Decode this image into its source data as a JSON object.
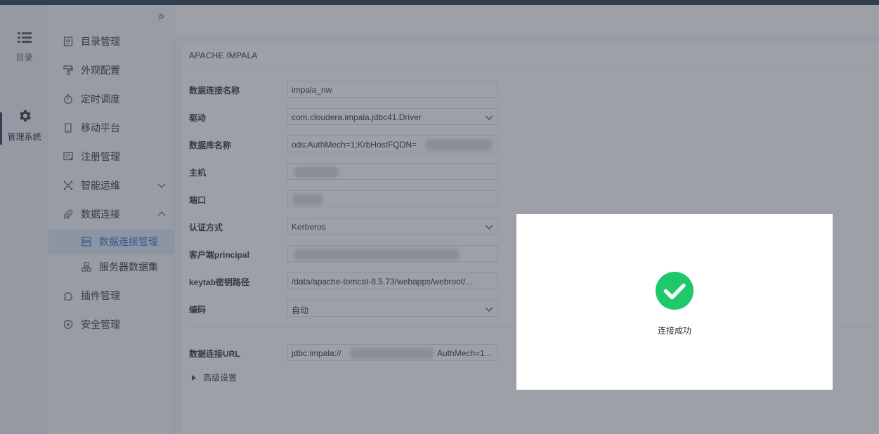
{
  "rail": {
    "items": [
      {
        "label": "目录",
        "icon": "list-icon"
      },
      {
        "label": "管理系统",
        "icon": "gear-icon"
      }
    ]
  },
  "menu": {
    "items": [
      {
        "label": "目录管理",
        "icon": "document-list-icon"
      },
      {
        "label": "外观配置",
        "icon": "paint-roller-icon"
      },
      {
        "label": "定时调度",
        "icon": "timer-icon"
      },
      {
        "label": "移动平台",
        "icon": "mobile-icon"
      },
      {
        "label": "注册管理",
        "icon": "register-icon"
      },
      {
        "label": "智能运维",
        "icon": "network-icon",
        "expanded": false
      },
      {
        "label": "数据连接",
        "icon": "link-icon",
        "expanded": true
      },
      {
        "label": "插件管理",
        "icon": "puzzle-icon"
      },
      {
        "label": "安全管理",
        "icon": "shield-icon"
      }
    ],
    "sub_items": [
      {
        "label": "数据连接管理",
        "icon": "database-link-icon",
        "active": true
      },
      {
        "label": "服务器数据集",
        "icon": "server-dataset-icon",
        "active": false
      }
    ]
  },
  "panel": {
    "title": "APACHE IMPALA",
    "fields": [
      {
        "label": "数据连接名称",
        "value": "impala_nw",
        "type": "text"
      },
      {
        "label": "驱动",
        "value": "com.cloudera.impala.jdbc41.Driver",
        "type": "select"
      },
      {
        "label": "数据库名称",
        "value": "ods;AuthMech=1;KrbHostFQDN=",
        "type": "text"
      },
      {
        "label": "主机",
        "value": "",
        "type": "text"
      },
      {
        "label": "端口",
        "value": "",
        "type": "text"
      },
      {
        "label": "认证方式",
        "value": "Kerberos",
        "type": "select"
      },
      {
        "label": "客户端principal",
        "value": "",
        "type": "text"
      },
      {
        "label": "keytab密钥路径",
        "value": "/data/apache-tomcat-8.5.73/webapps/webroot/...",
        "type": "text"
      },
      {
        "label": "编码",
        "value": "自动",
        "type": "select"
      }
    ],
    "url_label": "数据连接URL",
    "url_value_prefix": "jdbc:impala://",
    "url_value_suffix": "AuthMech=1...",
    "advanced_label": "高级设置"
  },
  "toast": {
    "message": "连接成功",
    "icon": "success-check-icon",
    "accent": "#1ec86b"
  },
  "colors": {
    "topbar": "#2b3a52",
    "active_menu_text": "#2f6fd6",
    "active_menu_bg": "#dfe8f7"
  }
}
